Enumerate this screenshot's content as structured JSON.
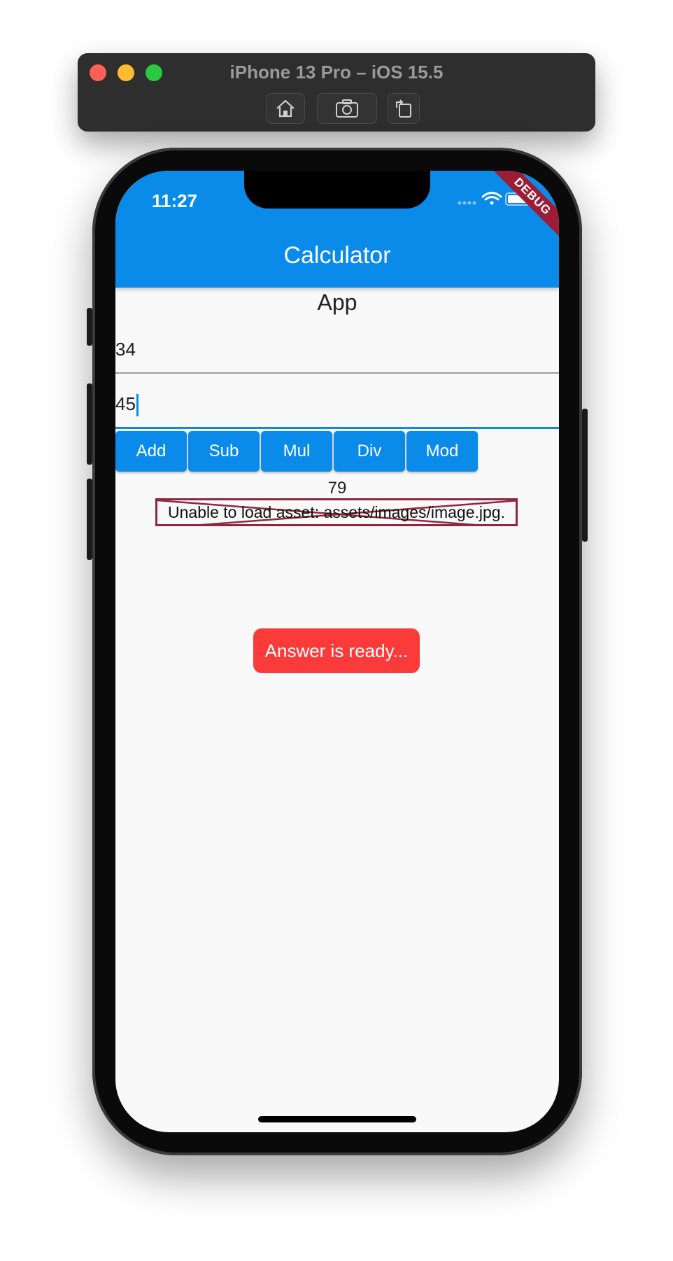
{
  "simulator": {
    "title": "iPhone 13 Pro – iOS 15.5",
    "buttons": [
      "home-icon",
      "screenshot-icon",
      "rotate-icon"
    ]
  },
  "status_bar": {
    "time": "11:27",
    "debug_label": "DEBUG"
  },
  "appbar": {
    "title": "Calculator"
  },
  "main": {
    "heading": "App",
    "input_1": "34",
    "input_2": "45",
    "buttons": [
      {
        "label": "Add"
      },
      {
        "label": "Sub"
      },
      {
        "label": "Mul"
      },
      {
        "label": "Div"
      },
      {
        "label": "Mod"
      }
    ],
    "result": "79",
    "image_error": "Unable to load asset: assets/images/image.jpg.",
    "toast": "Answer is ready..."
  },
  "colors": {
    "primary": "#0a8be9",
    "toast": "#fb3a3a",
    "error_border": "#8e2840"
  }
}
